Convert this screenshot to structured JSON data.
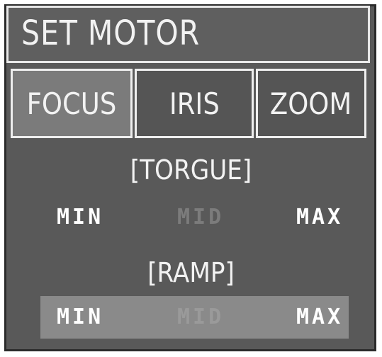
{
  "header": {
    "title": "SET MOTOR"
  },
  "tabs": [
    {
      "label": "FOCUS",
      "selected": true
    },
    {
      "label": "IRIS",
      "selected": false
    },
    {
      "label": "ZOOM",
      "selected": false
    }
  ],
  "torque": {
    "heading": "[TORGUE]",
    "options": [
      "MIN",
      "MID",
      "MAX"
    ],
    "selected": "MIN"
  },
  "ramp": {
    "heading": "[RAMP]",
    "options": [
      "MIN",
      "MID",
      "MAX"
    ],
    "selected": "MIN"
  },
  "colors": {
    "background": "#595959",
    "selected_tab": "#7b7b7b",
    "highlight_row": "#8a8a8a",
    "text": "#f2f2f2",
    "disabled_text": "#7c7c7c"
  }
}
